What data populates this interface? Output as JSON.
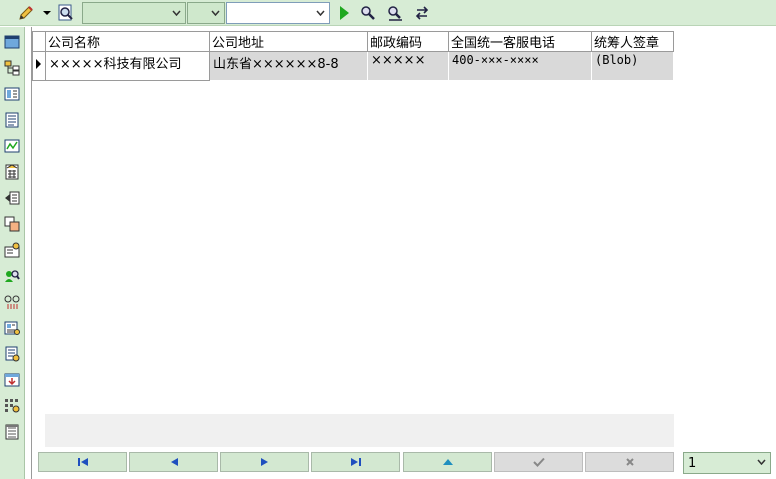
{
  "toolbar": {
    "icons": [
      "pencil-icon",
      "dropdown-arrow-icon",
      "preview-icon",
      "run-icon",
      "find-icon",
      "find-next-icon",
      "refresh-icon"
    ],
    "combo1_value": "",
    "combo2_value": "",
    "combo3_value": ""
  },
  "sidebar": {
    "icons": [
      "window-icon",
      "hierarchy-icon",
      "form-icon",
      "document-icon",
      "chart-icon",
      "calculator-icon",
      "export-icon",
      "layers-icon",
      "settings-icon",
      "user-search-icon",
      "link-icon",
      "report-icon",
      "list-settings-icon",
      "import-icon",
      "grid-settings-icon",
      "print-icon"
    ]
  },
  "grid": {
    "columns": [
      "公司名称",
      "公司地址",
      "邮政编码",
      "全国统一客服电话",
      "统筹人签章"
    ],
    "rows": [
      [
        "×××××科技有限公司",
        "山东省××××××8-8",
        "×××××",
        "400-×××-××××",
        "(Blob)"
      ]
    ]
  },
  "navigator": {
    "buttons": [
      "first-record",
      "prior-record",
      "next-record",
      "last-record",
      "edit",
      "post",
      "cancel"
    ]
  },
  "pager": {
    "current_page": "1"
  },
  "colors": {
    "toolbar_bg": "#d7ecd5",
    "selected_row": "#d9d9d9",
    "nav_arrow": "#1f4fbf",
    "run_green": "#1fa81f"
  }
}
